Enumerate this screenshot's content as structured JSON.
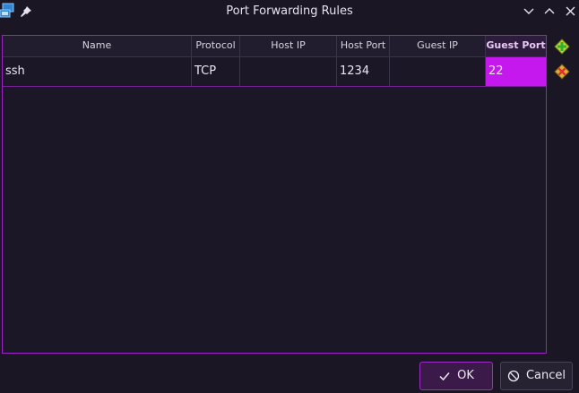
{
  "window": {
    "title": "Port Forwarding Rules"
  },
  "icons": {
    "app": "network-icon",
    "pin": "pin-icon",
    "minimize": "chevron-down-icon",
    "maximize": "chevron-up-icon",
    "close": "close-icon",
    "add_rule": "add-rule-icon",
    "remove_rule": "remove-rule-icon",
    "ok": "check-icon",
    "cancel": "cancel-icon"
  },
  "table": {
    "columns": [
      "Name",
      "Protocol",
      "Host IP",
      "Host Port",
      "Guest IP",
      "Guest Port"
    ],
    "rows": [
      {
        "name": "ssh",
        "protocol": "TCP",
        "host_ip": "",
        "host_port": "1234",
        "guest_ip": "",
        "guest_port": "22"
      }
    ]
  },
  "buttons": {
    "ok_label": "OK",
    "cancel_label": "Cancel"
  },
  "colors": {
    "accent": "#c418ef",
    "background": "#1a1623",
    "ok_border": "#9d2ac4"
  }
}
